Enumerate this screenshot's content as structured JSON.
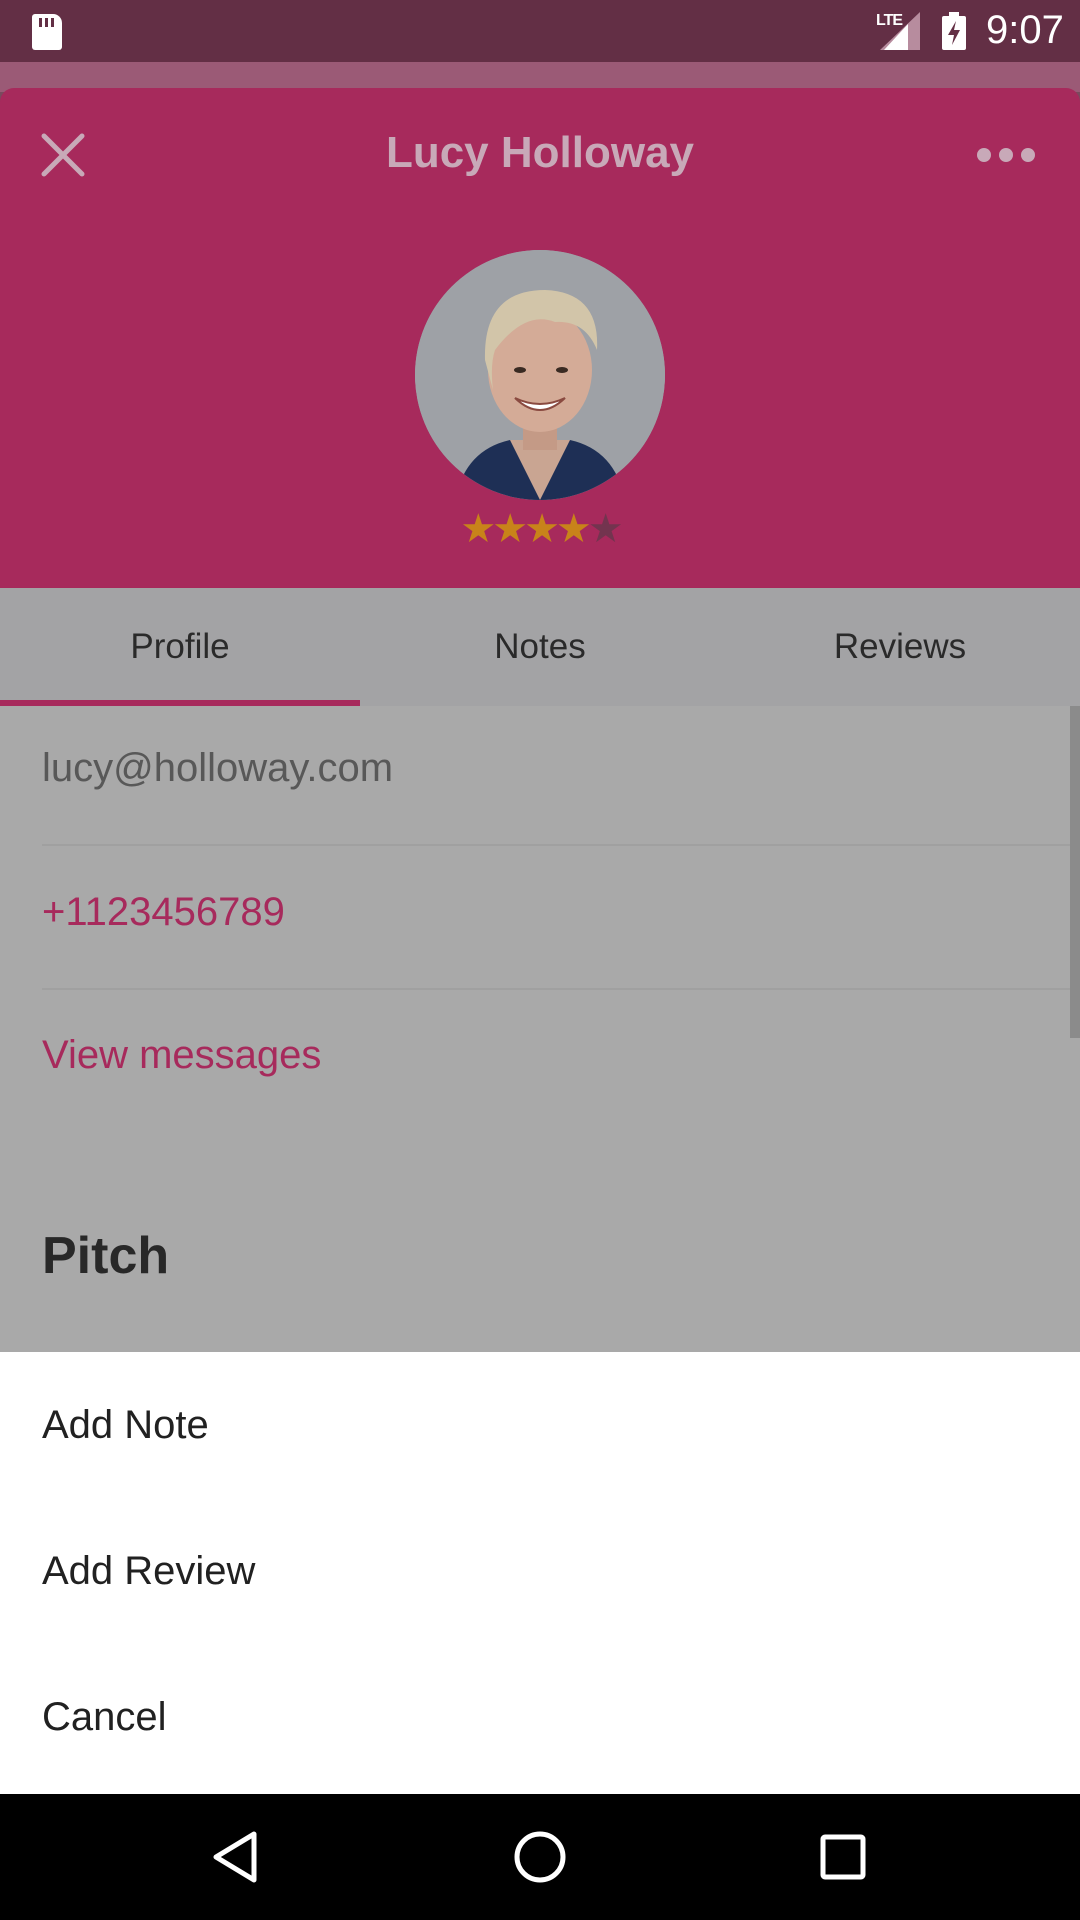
{
  "status_bar": {
    "network": "LTE",
    "time": "9:07",
    "icons": [
      "sd-card-icon",
      "signal-icon",
      "battery-charging-icon"
    ]
  },
  "header": {
    "title": "Lucy Holloway",
    "close_icon": "close-icon",
    "more_icon": "more-horizontal-icon",
    "rating": {
      "value": 4,
      "max": 5
    },
    "accent_color": "#a72a5c"
  },
  "tabs": [
    {
      "label": "Profile",
      "active": true
    },
    {
      "label": "Notes",
      "active": false
    },
    {
      "label": "Reviews",
      "active": false
    }
  ],
  "profile": {
    "email": "lucy@holloway.com",
    "phone": "+1123456789",
    "messages_link": "View messages",
    "section_heading": "Pitch"
  },
  "bottom_sheet": {
    "items": [
      {
        "label": "Add Note"
      },
      {
        "label": "Add Review"
      },
      {
        "label": "Cancel"
      }
    ]
  },
  "nav_bar": {
    "icons": [
      "back-icon",
      "home-icon",
      "recents-icon"
    ]
  }
}
